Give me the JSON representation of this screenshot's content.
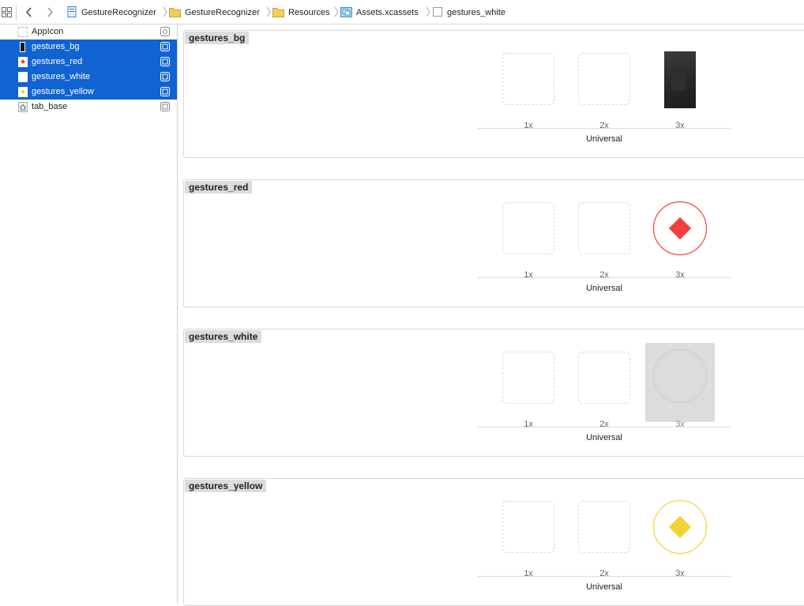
{
  "jumpbar": {
    "crumbs": [
      {
        "label": "GestureRecognizer",
        "icon": "project-file-icon"
      },
      {
        "label": "GestureRecognizer",
        "icon": "folder-icon"
      },
      {
        "label": "Resources",
        "icon": "folder-icon"
      },
      {
        "label": "Assets.xcassets",
        "icon": "asset-catalog-icon"
      },
      {
        "label": "gestures_white",
        "icon": "image-set-icon"
      }
    ]
  },
  "sidebar": {
    "items": [
      {
        "label": "AppIcon",
        "selected": false,
        "icon": "app-icon-set-icon"
      },
      {
        "label": "gestures_bg",
        "selected": true,
        "icon": "image-set-icon"
      },
      {
        "label": "gestures_red",
        "selected": true,
        "icon": "image-set-icon"
      },
      {
        "label": "gestures_white",
        "selected": true,
        "icon": "image-set-icon"
      },
      {
        "label": "gestures_yellow",
        "selected": true,
        "icon": "image-set-icon"
      },
      {
        "label": "tab_base",
        "selected": false,
        "icon": "image-set-icon"
      }
    ]
  },
  "sets": [
    {
      "name": "gestures_bg",
      "slots": [
        "1x",
        "2x",
        "3x"
      ],
      "idiom": "Universal",
      "image_3x": "dark-photo",
      "color": "#2b2d2b"
    },
    {
      "name": "gestures_red",
      "slots": [
        "1x",
        "2x",
        "3x"
      ],
      "idiom": "Universal",
      "image_3x": "red-diamond-in-circle",
      "color": "#f5403d"
    },
    {
      "name": "gestures_white",
      "slots": [
        "1x",
        "2x",
        "3x"
      ],
      "idiom": "Universal",
      "image_3x": "white-circle-selected",
      "color": "#ffffff"
    },
    {
      "name": "gestures_yellow",
      "slots": [
        "1x",
        "2x",
        "3x"
      ],
      "idiom": "Universal",
      "image_3x": "yellow-diamond-in-circle",
      "color": "#f2d336"
    }
  ],
  "colors": {
    "selection": "#1163d2",
    "folder": "#f3cd5a"
  }
}
